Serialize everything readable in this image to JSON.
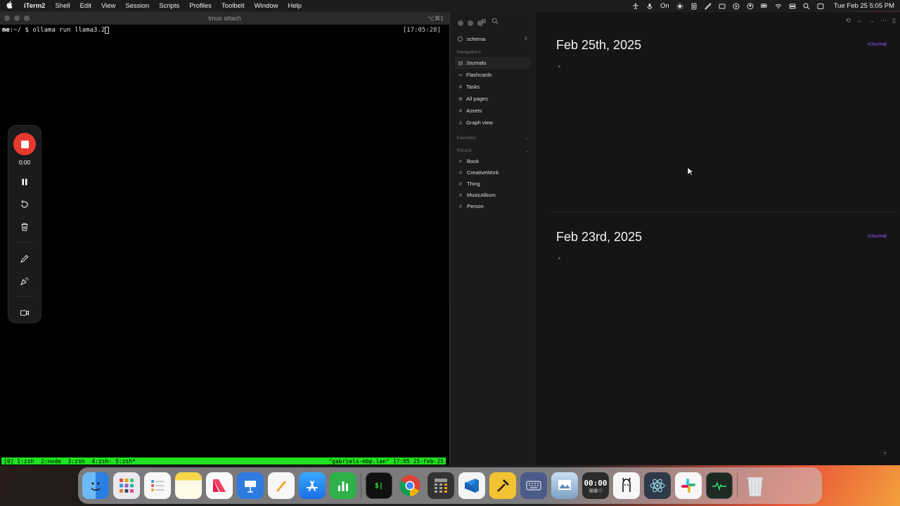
{
  "menubar": {
    "app_name": "iTerm2",
    "menus": [
      "Shell",
      "Edit",
      "View",
      "Session",
      "Scripts",
      "Profiles",
      "Toolbelt",
      "Window",
      "Help"
    ],
    "status_text": "On",
    "clock": "Tue Feb 25  5:05 PM"
  },
  "iterm": {
    "title": "tmux attach",
    "shortcut": "⌥⌘1",
    "prompt_user": "me",
    "prompt_path": ":~/ $ ",
    "command": "ollama run llama3.2",
    "tmux_time": "[17:05:28]",
    "tmux_windows": "[0] 1:zsh  2:node  3:zsh  4:zsh- 5:zsh*",
    "tmux_status_right": "\"gabriels-mbp.lan\" 17:05 25-Feb-25"
  },
  "recorder": {
    "timer": "0:00"
  },
  "logseq": {
    "graph_name": "schema",
    "navigations_label": "Navigations",
    "nav_items": [
      {
        "label": "Journals",
        "icon": "calendar-icon"
      },
      {
        "label": "Flashcards",
        "icon": "infinity-icon"
      },
      {
        "label": "Tasks",
        "icon": "hash-icon"
      },
      {
        "label": "All pages",
        "icon": "pages-icon"
      },
      {
        "label": "Assets",
        "icon": "hash-icon"
      },
      {
        "label": "Graph view",
        "icon": "graph-icon"
      }
    ],
    "favorites_label": "Favorites",
    "recent_label": "Recent",
    "recent_items": [
      "Book",
      "CreativeWork",
      "Thing",
      "MusicAlbum",
      "Person"
    ],
    "journals": [
      {
        "title": "Feb 25th, 2025",
        "tag": "#Journal"
      },
      {
        "title": "Feb 23rd, 2025",
        "tag": "#Journal"
      }
    ],
    "help": "?"
  },
  "dock": {
    "clock_widget": "00:00",
    "apps": [
      {
        "name": "finder-icon",
        "color": "#3a8ee6"
      },
      {
        "name": "launchpad-icon",
        "color": "#e9e9ee"
      },
      {
        "name": "reminders-icon",
        "color": "#f4f4f4"
      },
      {
        "name": "notes-icon",
        "color": "#f7d64a"
      },
      {
        "name": "news-icon",
        "color": "#f5f5f5"
      },
      {
        "name": "keynote-icon",
        "color": "#2f7be0"
      },
      {
        "name": "pages-icon",
        "color": "#f3a12c"
      },
      {
        "name": "app-store-icon",
        "color": "#2d8ef5"
      },
      {
        "name": "numbers-icon",
        "color": "#2fb14a"
      },
      {
        "name": "iterm-icon",
        "color": "#111111"
      },
      {
        "name": "chrome-icon",
        "color": "#f0f0f0"
      },
      {
        "name": "calculator-icon",
        "color": "#333333"
      },
      {
        "name": "vscode-icon",
        "color": "#1f6fbf"
      },
      {
        "name": "hammer-icon",
        "color": "#f3c231"
      },
      {
        "name": "keyboard-icon",
        "color": "#5a6a9a"
      },
      {
        "name": "preview-icon",
        "color": "#8aa8c8"
      },
      {
        "name": "stopwatch-icon",
        "color": "#2b2b2b"
      },
      {
        "name": "ollama-icon",
        "color": "#f5f5f5"
      },
      {
        "name": "electron-icon",
        "color": "#2f3a48"
      },
      {
        "name": "slack-icon",
        "color": "#f5f5f5"
      },
      {
        "name": "activity-monitor-icon",
        "color": "#1d2a22"
      },
      {
        "name": "trash-icon",
        "color": "#d8d8de"
      }
    ]
  }
}
